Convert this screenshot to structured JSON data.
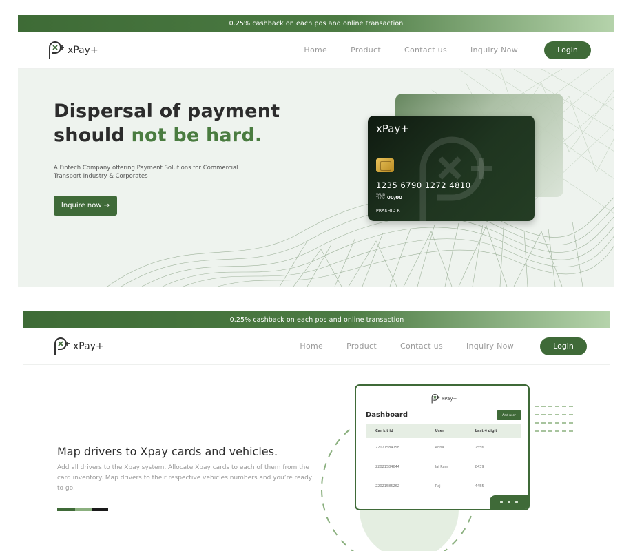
{
  "promo_text": "0.25% cashback on each pos and online transaction",
  "brand": "xPay+",
  "nav": {
    "links": [
      "Home",
      "Product",
      "Contact us",
      "Inquiry Now"
    ],
    "login": "Login"
  },
  "hero": {
    "title_line1": "Dispersal of payment",
    "title_line2_pre": "should ",
    "title_line2_accent": "not be hard.",
    "subtitle": "A Fintech Company offering Payment Solutions for Commercial Transport Industry & Corporates",
    "cta": "Inquire now →",
    "card": {
      "brand": "xPay+",
      "number": "1235 6790  1272  4810",
      "valid_label": "VALID THRU",
      "expiry": "00/00",
      "holder": "PRASHID K"
    }
  },
  "section2": {
    "title": "Map drivers to Xpay cards and vehicles.",
    "description": "Add all drivers to the Xpay system. Allocate Xpay cards to each of them from the card inventory. Map drivers to their respective vehicles numbers and you’re ready to go.",
    "dashboard": {
      "brand": "xPay+",
      "title": "Dashboard",
      "add_user": "Add user",
      "columns": [
        "Car kit id",
        "User",
        "Last 4 digit"
      ],
      "rows": [
        [
          "22021584758",
          "Anna",
          "2556"
        ],
        [
          "22021584644",
          "Jai Ram",
          "8439"
        ],
        [
          "22021585262",
          "Raj",
          "4455"
        ]
      ]
    }
  },
  "colors": {
    "primary": "#3f6a38",
    "accent": "#4a7c40",
    "hero_bg": "#eef3ee"
  }
}
